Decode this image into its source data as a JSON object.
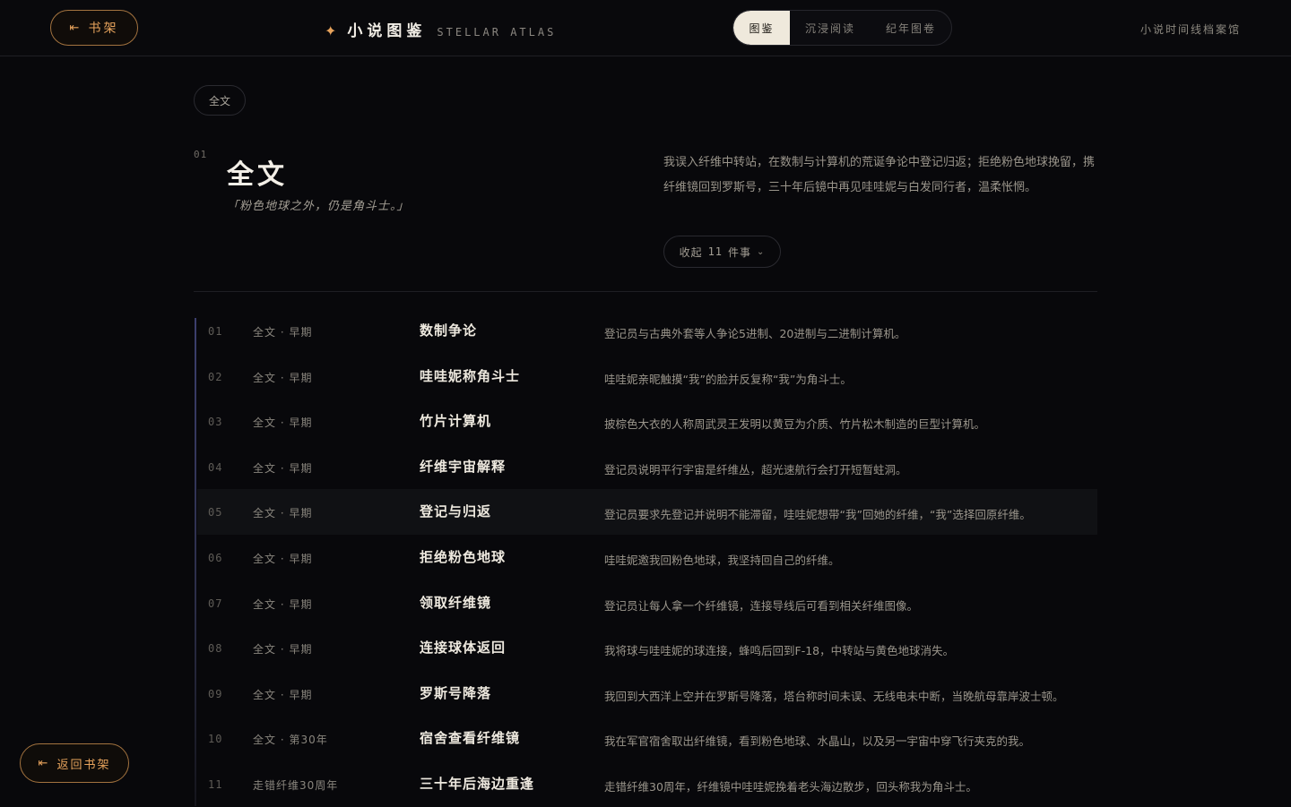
{
  "topbar": {
    "shelf_label": "书架",
    "brand_star": "✦",
    "brand_name": "小说图鉴",
    "brand_sub": "STELLAR ATLAS",
    "tabs": [
      {
        "label": "图鉴",
        "active": true
      },
      {
        "label": "沉浸阅读",
        "active": false
      },
      {
        "label": "纪年图卷",
        "active": false
      }
    ],
    "archive_link": "小说时间线档案馆"
  },
  "filter": {
    "chip_label": "全文"
  },
  "section": {
    "number": "01",
    "title": "全文",
    "quote": "「粉色地球之外，仍是角斗士。」",
    "description": "我误入纤维中转站，在数制与计算机的荒诞争论中登记归返；拒绝粉色地球挽留，携纤维镜回到罗斯号，三十年后镜中再见哇哇妮与白发同行者，温柔怅惘。",
    "collapse": {
      "prefix": "收起",
      "count": "11",
      "suffix": "件事",
      "chevron": "⌄"
    }
  },
  "events": [
    {
      "num": "01",
      "tag": "全文 · 早期",
      "title": "数制争论",
      "desc": "登记员与古典外套等人争论5进制、20进制与二进制计算机。"
    },
    {
      "num": "02",
      "tag": "全文 · 早期",
      "title": "哇哇妮称角斗士",
      "desc": "哇哇妮亲昵触摸“我”的脸并反复称“我”为角斗士。"
    },
    {
      "num": "03",
      "tag": "全文 · 早期",
      "title": "竹片计算机",
      "desc": "披棕色大衣的人称周武灵王发明以黄豆为介质、竹片松木制造的巨型计算机。"
    },
    {
      "num": "04",
      "tag": "全文 · 早期",
      "title": "纤维宇宙解释",
      "desc": "登记员说明平行宇宙是纤维丛，超光速航行会打开短暂蛀洞。"
    },
    {
      "num": "05",
      "tag": "全文 · 早期",
      "title": "登记与归返",
      "desc": "登记员要求先登记并说明不能滞留，哇哇妮想带“我”回她的纤维，“我”选择回原纤维。",
      "highlight": true
    },
    {
      "num": "06",
      "tag": "全文 · 早期",
      "title": "拒绝粉色地球",
      "desc": "哇哇妮邀我回粉色地球，我坚持回自己的纤维。"
    },
    {
      "num": "07",
      "tag": "全文 · 早期",
      "title": "领取纤维镜",
      "desc": "登记员让每人拿一个纤维镜，连接导线后可看到相关纤维图像。"
    },
    {
      "num": "08",
      "tag": "全文 · 早期",
      "title": "连接球体返回",
      "desc": "我将球与哇哇妮的球连接，蜂鸣后回到F-18，中转站与黄色地球消失。"
    },
    {
      "num": "09",
      "tag": "全文 · 早期",
      "title": "罗斯号降落",
      "desc": "我回到大西洋上空并在罗斯号降落，塔台称时间未误、无线电未中断，当晚航母靠岸波士顿。"
    },
    {
      "num": "10",
      "tag": "全文 · 第30年",
      "title": "宿舍查看纤维镜",
      "desc": "我在军官宿舍取出纤维镜，看到粉色地球、水晶山，以及另一宇宙中穿飞行夹克的我。"
    },
    {
      "num": "11",
      "tag": "走错纤维30周年",
      "title": "三十年后海边重逢",
      "desc": "走错纤维30周年，纤维镜中哇哇妮挽着老头海边散步，回头称我为角斗士。"
    }
  ],
  "footer": {
    "back_label": "返回书架"
  },
  "icons": {
    "shelf": "arrow-left-bar-icon",
    "back": "arrow-left-bar-icon"
  },
  "colors": {
    "accent": "#e7a35c",
    "background": "#08080b",
    "timeline": "#3c3f6e"
  }
}
